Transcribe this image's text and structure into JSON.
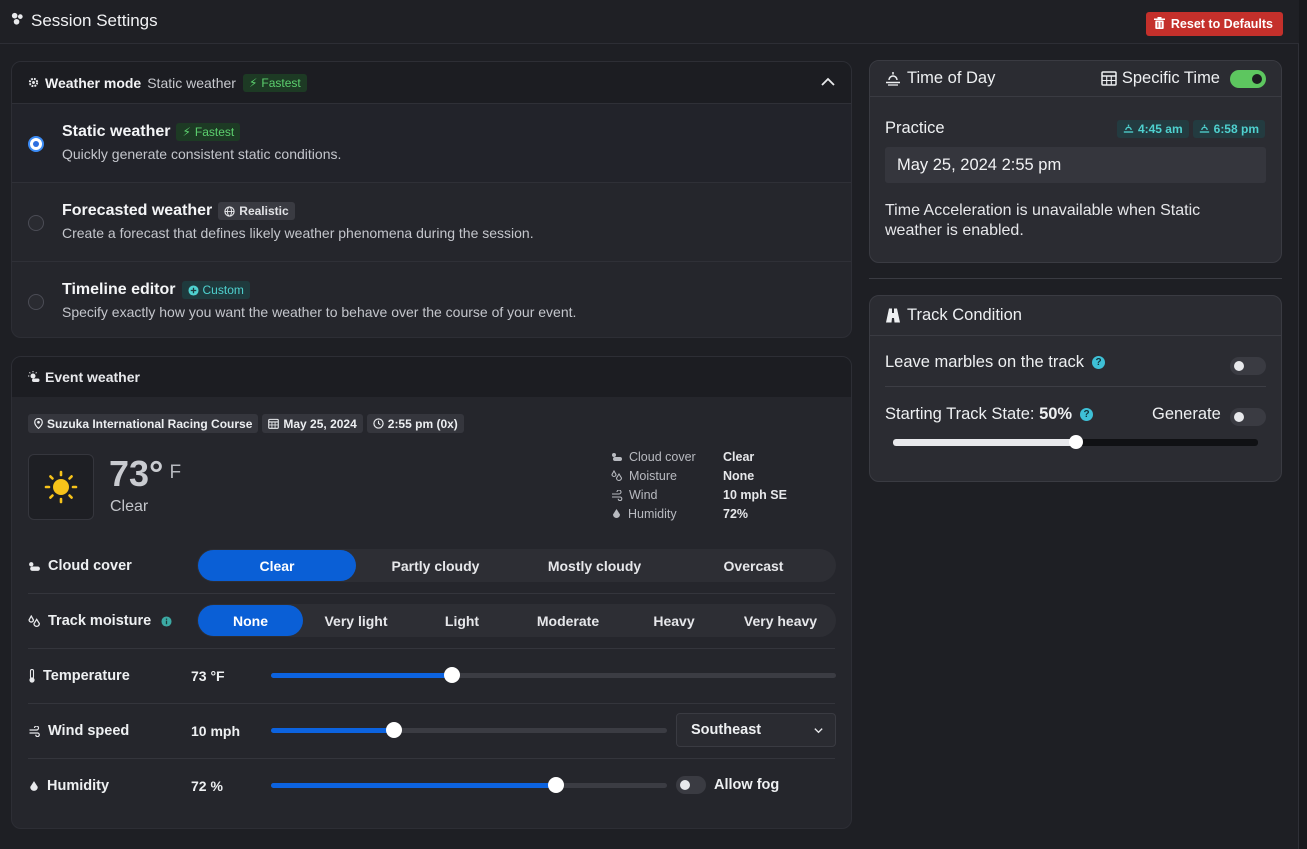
{
  "header": {
    "title": "Session Settings",
    "reset_label": "Reset to Defaults"
  },
  "weather_mode": {
    "label": "Weather mode",
    "current": "Static weather",
    "current_badge": "Fastest",
    "options": [
      {
        "title": "Static weather",
        "badge": "Fastest",
        "desc": "Quickly generate consistent static conditions.",
        "selected": true
      },
      {
        "title": "Forecasted weather",
        "badge": "Realistic",
        "desc": "Create a forecast that defines likely weather phenomena during the session.",
        "selected": false
      },
      {
        "title": "Timeline editor",
        "badge": "Custom",
        "desc": "Specify exactly how you want the weather to behave over the course of your event.",
        "selected": false
      }
    ]
  },
  "event_weather": {
    "title": "Event weather",
    "chips": {
      "track": "Suzuka International Racing Course",
      "date": "May 25, 2024",
      "time": "2:55 pm (0x)"
    },
    "current": {
      "temp": "73°",
      "unit": "F",
      "condition": "Clear"
    },
    "stats": [
      {
        "label": "Cloud cover",
        "value": "Clear",
        "icon": "cloud-icon"
      },
      {
        "label": "Moisture",
        "value": "None",
        "icon": "droplets-icon"
      },
      {
        "label": "Wind",
        "value": "10 mph SE",
        "icon": "wind-icon"
      },
      {
        "label": "Humidity",
        "value": "72%",
        "icon": "humidity-icon"
      }
    ],
    "cloud_cover": {
      "label": "Cloud cover",
      "options": [
        "Clear",
        "Partly cloudy",
        "Mostly cloudy",
        "Overcast"
      ],
      "selected": 0
    },
    "track_moisture": {
      "label": "Track moisture",
      "options": [
        "None",
        "Very light",
        "Light",
        "Moderate",
        "Heavy",
        "Very heavy"
      ],
      "selected": 0
    },
    "temperature": {
      "label": "Temperature",
      "value": "73 °F",
      "fraction": 0.32
    },
    "wind_speed": {
      "label": "Wind speed",
      "value": "10 mph",
      "fraction": 0.31,
      "direction": "Southeast"
    },
    "humidity": {
      "label": "Humidity",
      "value": "72 %",
      "fraction": 0.72,
      "fog_label": "Allow fog",
      "fog_enabled": false
    }
  },
  "time_of_day": {
    "title": "Time of Day",
    "specific_time_label": "Specific Time",
    "specific_time_enabled": true,
    "session": "Practice",
    "sunrise": "4:45 am",
    "sunset": "6:58 pm",
    "datetime": "May 25, 2024 2:55 pm",
    "note": "Time Acceleration is unavailable when Static weather is enabled."
  },
  "track_condition": {
    "title": "Track Condition",
    "marbles_label": "Leave marbles on the track",
    "marbles_enabled": false,
    "state_label": "Starting Track State:",
    "state_value": "50%",
    "state_fraction": 0.5,
    "generate_label": "Generate",
    "generate_enabled": false
  }
}
